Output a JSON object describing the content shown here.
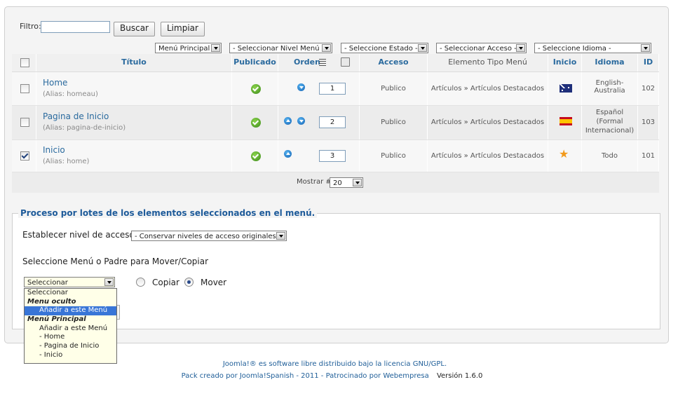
{
  "filter": {
    "label": "Filtro:",
    "value": "",
    "search_button": "Buscar",
    "clear_button": "Limpiar"
  },
  "filters": {
    "menu": "Menú Principal",
    "level": "- Seleccionar Nivel Menú -",
    "state": "- Seleccione Estado -",
    "access": "- Seleccionar Acceso -",
    "language": "- Seleccione Idioma -"
  },
  "table": {
    "headers": {
      "title": "Título",
      "published": "Publicado",
      "order": "Orden",
      "access": "Acceso",
      "type": "Elemento Tipo Menú",
      "home": "Inicio",
      "language": "Idioma",
      "id": "ID"
    },
    "rows": [
      {
        "title": "Home",
        "alias": "(Alias: homeau)",
        "order": "1",
        "access": "Publico",
        "type": "Artículos » Artículos Destacados",
        "lang": "English-Australia",
        "lang_l1": "English-",
        "lang_l2": "Australia",
        "lang_l3": "",
        "id": "102",
        "checked": false
      },
      {
        "title": "Pagina de Inicio",
        "alias": "(Alias: pagina-de-inicio)",
        "order": "2",
        "access": "Publico",
        "type": "Artículos » Artículos Destacados",
        "lang_l1": "Español",
        "lang_l2": "(Formal",
        "lang_l3": "Internacional)",
        "id": "103",
        "checked": false
      },
      {
        "title": "Inicio",
        "alias": "(Alias: home)",
        "order": "3",
        "access": "Publico",
        "type": "Artículos » Artículos Destacados",
        "lang_l1": "Todo",
        "lang_l2": "",
        "lang_l3": "",
        "id": "101",
        "checked": true
      }
    ]
  },
  "pagination": {
    "label": "Mostrar #",
    "value": "20"
  },
  "batch": {
    "legend": "Proceso por lotes de los elementos seleccionados en el menú.",
    "access_label": "Establecer nivel de acceso",
    "access_value": "- Conservar niveles de acceso originales -",
    "move_label": "Seleccione Menú o Padre para Mover/Copiar",
    "target_value": "Seleccionar",
    "copy_label": "Copiar",
    "move_option": "Mover",
    "dropdown": {
      "o1": "Seleccionar",
      "g1": "Menu oculto",
      "o2": "Añadir a este Menú",
      "g2": "Menú Principal",
      "o3": "Añadir a este Menú",
      "o4": "- Home",
      "o5": "- Pagina de Inicio",
      "o6": "- Inicio"
    }
  },
  "footer": {
    "line1": "Joomla!® es software libre distribuido bajo la licencia GNU/GPL.",
    "line2_link": "Pack creado por Joomla!Spanish - 2011 - Patrocinado por Webempresa",
    "version": "Versión 1.6.0"
  }
}
